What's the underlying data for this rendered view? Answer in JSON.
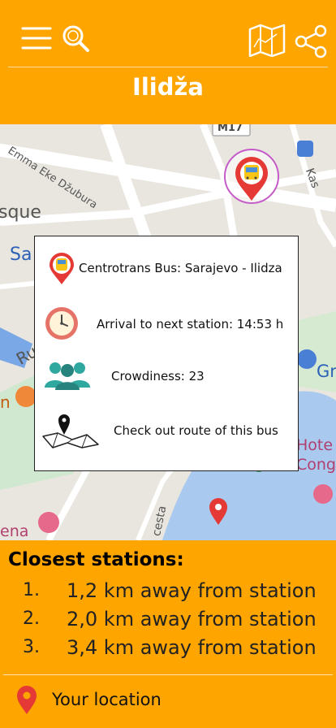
{
  "header": {
    "title": "Ilidža",
    "icons": [
      "menu-icon",
      "search-icon",
      "map-icon",
      "share-icon"
    ]
  },
  "map": {
    "labels": {
      "street1": "Emma Eke Džubura",
      "street2": "cesta",
      "road_badge": "M17",
      "frag_sque": "sque",
      "frag_sa": "Sa",
      "frag_ru": "Ru",
      "frag_n": "n",
      "frag_ena": "ena",
      "frag_kas": "Kas",
      "frag_gr": "Gr",
      "frag_hote": "Hote",
      "frag_cong": "Cong"
    },
    "colors": {
      "pin_red": "#E53935",
      "bus_yellow": "#F9C518"
    }
  },
  "popup": {
    "bus_name": "Centrotrans Bus: Sarajevo - Ilidza",
    "arrival": "Arrival to next station: 14:53 h",
    "crowdiness": "Crowdiness: 23",
    "route": "Check out route of this bus"
  },
  "stations": {
    "title": "Closest stations:",
    "items": [
      {
        "num": "1.",
        "text": "1,2 km away from station"
      },
      {
        "num": "2.",
        "text": "2,0 km away from station"
      },
      {
        "num": "3.",
        "text": "3,4 km away from station"
      }
    ]
  },
  "location": {
    "label": "Your location"
  },
  "colors": {
    "accent": "#FFA500",
    "text_white": "#FFFFFF"
  }
}
